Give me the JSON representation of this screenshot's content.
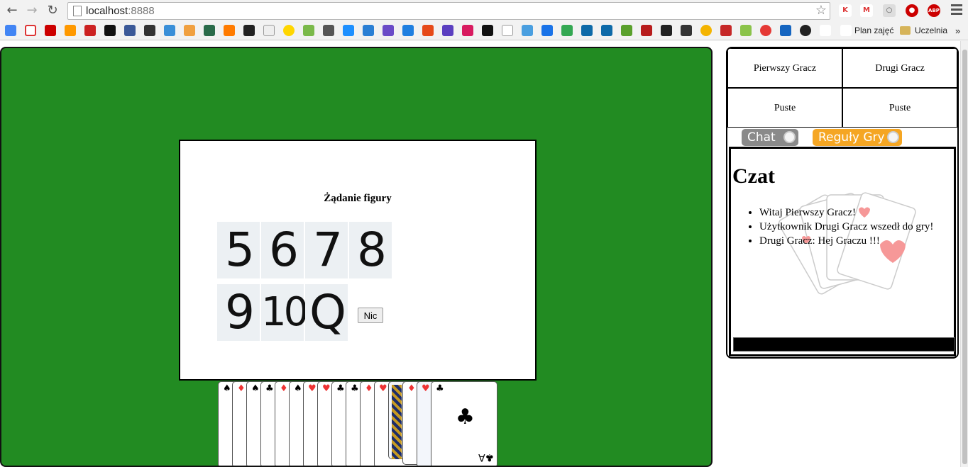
{
  "browser": {
    "url_host": "localhost",
    "url_port": ":8888",
    "back_icon": "back-arrow-icon",
    "forward_icon": "forward-arrow-icon",
    "reload_icon": "reload-icon"
  },
  "bookmarks": {
    "plan_label": "Plan zajęć",
    "folder_label": "Uczelnia",
    "overflow": "»"
  },
  "modal": {
    "title": "Żądanie figury",
    "ranks": [
      "5",
      "6",
      "7",
      "8",
      "9",
      "10",
      "Q"
    ],
    "nic_label": "Nic"
  },
  "players": {
    "first_label": "Pierwszy Gracz",
    "second_label": "Drugi Gracz",
    "first_status": "Puste",
    "second_status": "Puste"
  },
  "tabs": {
    "chat_label": "Chat",
    "rules_label": "Reguły Gry",
    "chat_color": "#8a8a8a",
    "rules_color": "#f5a623"
  },
  "chat": {
    "heading": "Czat",
    "messages": [
      "Witaj Pierwszy Gracz!",
      "Użytkownik Drugi Gracz wszedł do gry!",
      "Drugi Gracz: Hej Graczu !!!"
    ]
  },
  "colors": {
    "table_green": "#228b22"
  }
}
